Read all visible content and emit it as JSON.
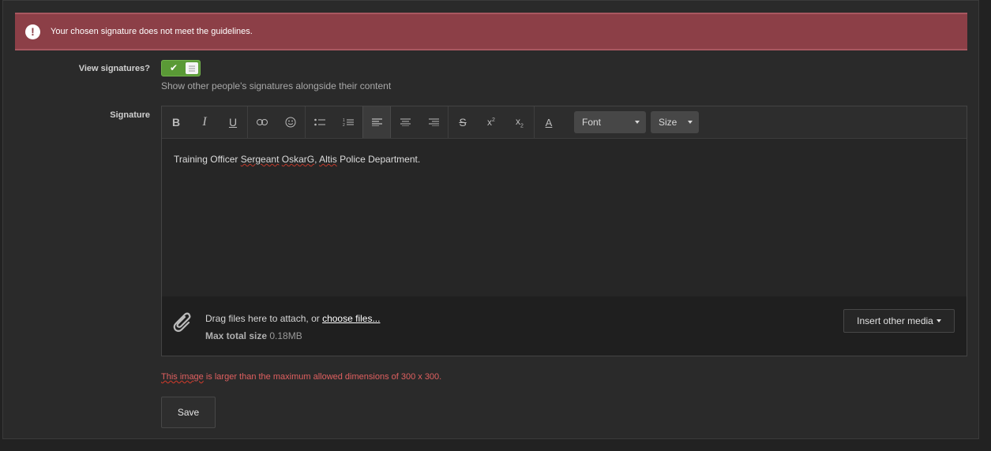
{
  "error_banner": {
    "icon": "exclamation-circle-icon",
    "message": "Your chosen signature does not meet the guidelines.",
    "color": "#8c3f47"
  },
  "view_signatures": {
    "label": "View signatures?",
    "toggle_on": true,
    "hint": "Show other people's signatures alongside their content",
    "color": "#5a9a36"
  },
  "signature": {
    "label": "Signature",
    "toolbar": {
      "buttons": [
        "bold-icon",
        "italic-icon",
        "underline-icon",
        "link-icon",
        "smiley-icon",
        "bullet-list-icon",
        "numbered-list-icon",
        "align-left-icon",
        "align-center-icon",
        "align-right-icon",
        "strikethrough-icon",
        "superscript-icon",
        "subscript-icon",
        "text-color-icon"
      ],
      "active": "align-left-icon",
      "font_label": "Font",
      "size_label": "Size"
    },
    "content": {
      "part1": "Training Officer ",
      "word_sergeant": "Sergeant",
      "space": " ",
      "word_oskarg": "OskarG",
      "comma": ", ",
      "word_altis": "Altis",
      "part_end": " Police Department."
    },
    "attach": {
      "icon": "paperclip-icon",
      "drag_text": "Drag files here to attach, or ",
      "choose_link": "choose files...",
      "max_label": "Max total size",
      "max_value": "0.18MB",
      "insert_media_label": "Insert other media"
    }
  },
  "image_error": {
    "underlined": "This image",
    "rest": " is larger than the maximum allowed dimensions of 300 x 300."
  },
  "save_label": "Save"
}
